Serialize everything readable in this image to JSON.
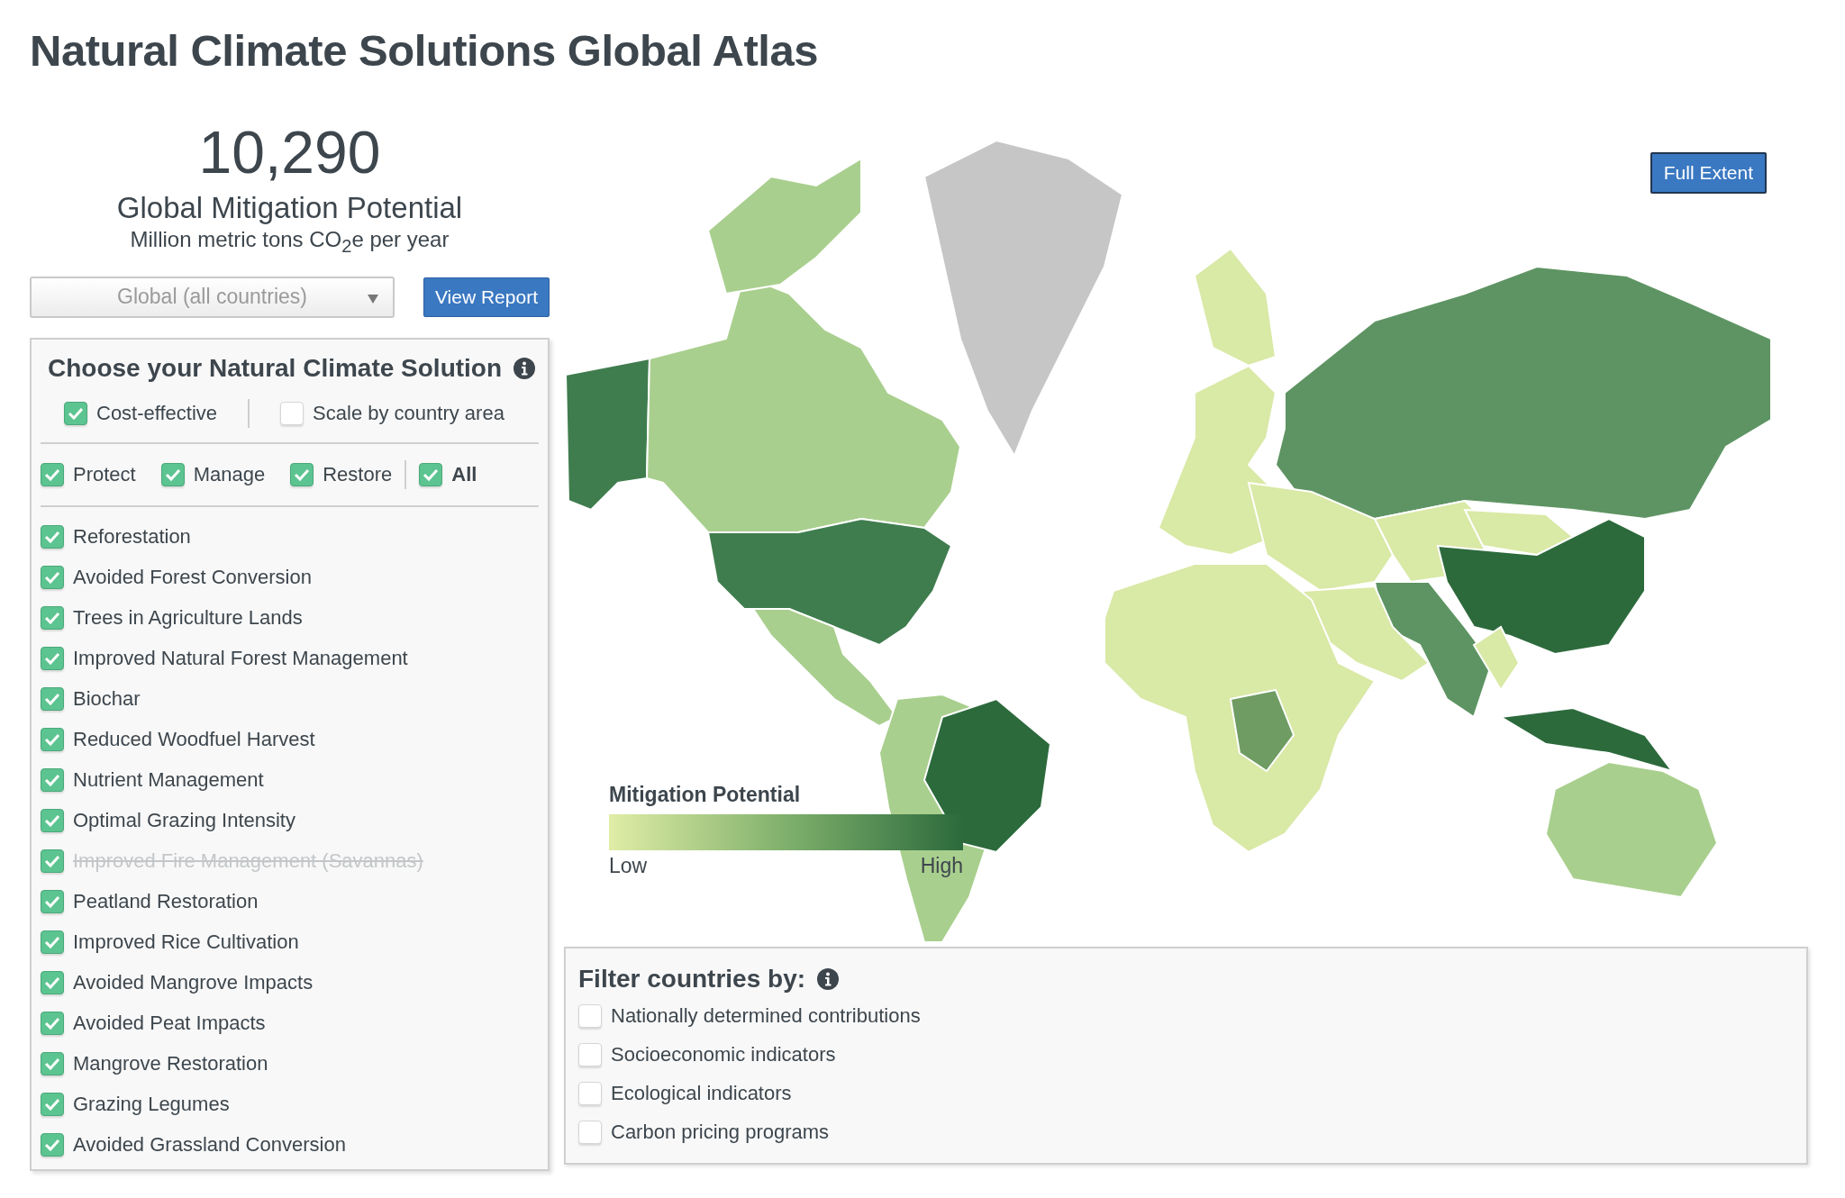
{
  "title": "Natural Climate Solutions Global Atlas",
  "summary": {
    "value": "10,290",
    "label": "Global Mitigation Potential",
    "unit": "Million metric tons CO$_{2}$e per year"
  },
  "region_select": {
    "value": "Global (all countries)"
  },
  "view_report_button": "View Report",
  "solution_panel": {
    "title": "Choose your Natural Climate Solution",
    "options": [
      {
        "label": "Cost-effective",
        "checked": true
      },
      {
        "label": "Scale by country area",
        "checked": false
      }
    ],
    "categories": [
      {
        "label": "Protect",
        "checked": true,
        "kind": "category"
      },
      {
        "label": "Manage",
        "checked": true,
        "kind": "category"
      },
      {
        "label": "Restore",
        "checked": true,
        "kind": "category"
      },
      {
        "label": "All",
        "checked": true,
        "kind": "all"
      }
    ],
    "solutions": [
      {
        "label": "Reforestation",
        "checked": true,
        "disabled": false
      },
      {
        "label": "Avoided Forest Conversion",
        "checked": true,
        "disabled": false
      },
      {
        "label": "Trees in Agriculture Lands",
        "checked": true,
        "disabled": false
      },
      {
        "label": "Improved Natural Forest Management",
        "checked": true,
        "disabled": false
      },
      {
        "label": "Biochar",
        "checked": true,
        "disabled": false
      },
      {
        "label": "Reduced Woodfuel Harvest",
        "checked": true,
        "disabled": false
      },
      {
        "label": "Nutrient Management",
        "checked": true,
        "disabled": false
      },
      {
        "label": "Optimal Grazing Intensity",
        "checked": true,
        "disabled": false
      },
      {
        "label": "Improved Fire Management (Savannas)",
        "checked": true,
        "disabled": true
      },
      {
        "label": "Peatland Restoration",
        "checked": true,
        "disabled": false
      },
      {
        "label": "Improved Rice Cultivation",
        "checked": true,
        "disabled": false
      },
      {
        "label": "Avoided Mangrove Impacts",
        "checked": true,
        "disabled": false
      },
      {
        "label": "Avoided Peat Impacts",
        "checked": true,
        "disabled": false
      },
      {
        "label": "Mangrove Restoration",
        "checked": true,
        "disabled": false
      },
      {
        "label": "Grazing Legumes",
        "checked": true,
        "disabled": false
      },
      {
        "label": "Avoided Grassland Conversion",
        "checked": true,
        "disabled": false
      }
    ]
  },
  "full_extent_button": "Full Extent",
  "legend": {
    "title": "Mitigation Potential",
    "low": "Low",
    "high": "High"
  },
  "filter_panel": {
    "title": "Filter countries by:",
    "options": [
      {
        "label": "Nationally determined contributions",
        "checked": false
      },
      {
        "label": "Socioeconomic indicators",
        "checked": false
      },
      {
        "label": "Ecological indicators",
        "checked": false
      },
      {
        "label": "Carbon pricing programs",
        "checked": false
      }
    ]
  }
}
